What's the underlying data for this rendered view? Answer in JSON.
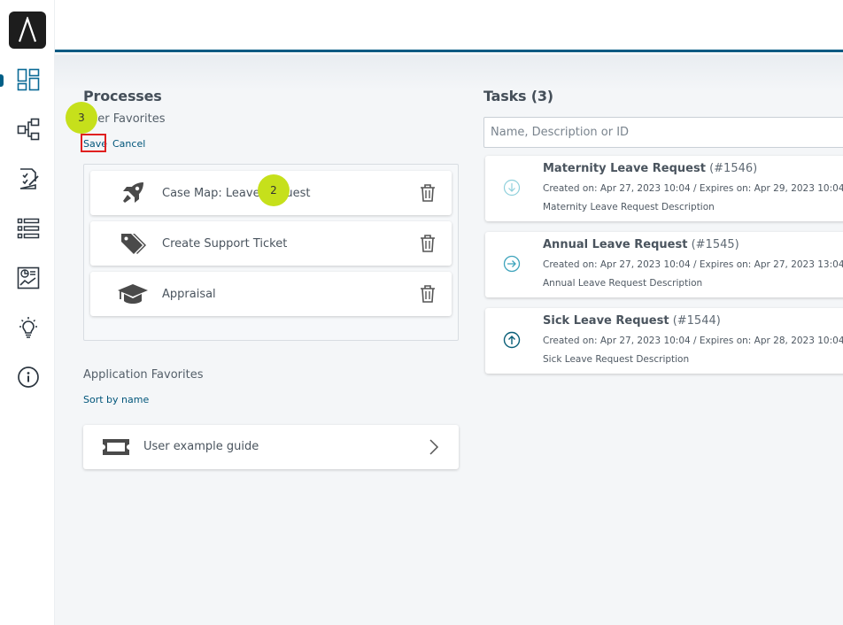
{
  "sidebar": {
    "logo": "logo",
    "items": [
      {
        "icon": "dashboard-icon",
        "active": true
      },
      {
        "icon": "process-map-icon"
      },
      {
        "icon": "checklist-document-icon"
      },
      {
        "icon": "list-icon"
      },
      {
        "icon": "report-chart-icon"
      },
      {
        "icon": "lightbulb-icon"
      },
      {
        "icon": "info-icon"
      }
    ]
  },
  "processes": {
    "title": "Processes",
    "user_favorites_label": "User Favorites",
    "save_label": "Save",
    "cancel_label": "Cancel",
    "items": [
      {
        "label": "Case Map: Leave Request",
        "icon": "rocket-icon"
      },
      {
        "label": "Create Support Ticket",
        "icon": "tag-icon"
      },
      {
        "label": "Appraisal",
        "icon": "graduation-cap-icon"
      }
    ]
  },
  "applications": {
    "title": "Application Favorites",
    "sort_label": "Sort by name",
    "items": [
      {
        "label": "User example guide",
        "icon": "ticket-icon"
      }
    ]
  },
  "tasks": {
    "title": "Tasks (3)",
    "search_placeholder": "Name, Description or ID",
    "items": [
      {
        "name": "Maternity Leave Request",
        "id": "(#1546)",
        "dates": "Created on: Apr 27, 2023 10:04 / Expires on: Apr 29, 2023 10:04",
        "description": "Maternity Leave Request Description",
        "priority_icon": "arrow-down-circle-icon"
      },
      {
        "name": "Annual Leave Request",
        "id": "(#1545)",
        "dates": "Created on: Apr 27, 2023 10:04 / Expires on: Apr 27, 2023 13:04",
        "description": "Annual Leave Request Description",
        "priority_icon": "arrow-right-circle-icon"
      },
      {
        "name": "Sick Leave Request",
        "id": "(#1544)",
        "dates": "Created on: Apr 27, 2023 10:04 / Expires on: Apr 28, 2023 10:04",
        "description": "Sick Leave Request Description",
        "priority_icon": "arrow-up-circle-icon"
      }
    ]
  },
  "steps": {
    "step_a": "3",
    "step_b": "2"
  },
  "colors": {
    "accent": "#005a82",
    "step_marker": "#c6e01b",
    "highlight_box": "#e02020"
  }
}
